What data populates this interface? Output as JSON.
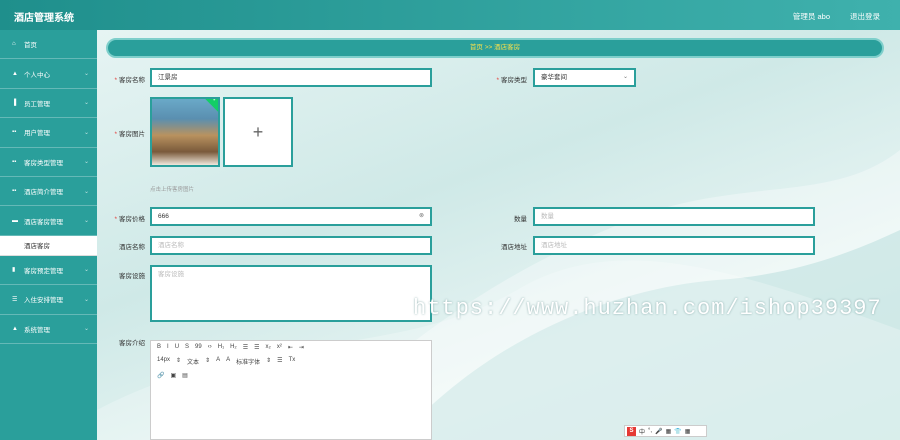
{
  "app": {
    "title": "酒店管理系统",
    "admin": "管理员 abo",
    "logout": "退出登录"
  },
  "sidebar": {
    "items": [
      {
        "label": "首页",
        "icon": "home-icon",
        "glyph": "⌂"
      },
      {
        "label": "个人中心",
        "icon": "user-icon",
        "glyph": "▲"
      },
      {
        "label": "员工管理",
        "icon": "bar-icon",
        "glyph": "▐"
      },
      {
        "label": "用户管理",
        "icon": "grid-icon",
        "glyph": "▪▪"
      },
      {
        "label": "客房类型管理",
        "icon": "grid-icon",
        "glyph": "▪▪"
      },
      {
        "label": "酒店简介管理",
        "icon": "grid-icon",
        "glyph": "▪▪"
      },
      {
        "label": "酒店客房管理",
        "icon": "chat-icon",
        "glyph": "▬"
      },
      {
        "sub": "酒店客房"
      },
      {
        "label": "客房预定管理",
        "icon": "chart-icon",
        "glyph": "▮"
      },
      {
        "label": "入住安排管理",
        "icon": "list-icon",
        "glyph": "☰"
      },
      {
        "label": "系统管理",
        "icon": "user-icon",
        "glyph": "▲"
      }
    ]
  },
  "breadcrumb": {
    "text": "首页 >> 酒店客房"
  },
  "form": {
    "room_name": {
      "label": "客房名称",
      "value": "江景房"
    },
    "room_type": {
      "label": "客房类型",
      "value": "豪华套间"
    },
    "room_image": {
      "label": "客房图片",
      "hint": "点击上传客房图片",
      "plus": "+"
    },
    "price": {
      "label": "客房价格",
      "value": "666"
    },
    "quantity": {
      "label": "数量",
      "placeholder": "数量"
    },
    "hotel_name": {
      "label": "酒店名称",
      "placeholder": "酒店名称"
    },
    "hotel_address": {
      "label": "酒店地址",
      "placeholder": "酒店地址"
    },
    "facilities": {
      "label": "客房设施",
      "placeholder": "客房设施"
    },
    "intro": {
      "label": "客房介绍"
    }
  },
  "editor": {
    "row1": [
      "B",
      "I",
      "U",
      "S",
      "99",
      "‹›",
      "H₁",
      "H₂",
      "☰",
      "☰",
      "x₂",
      "x²",
      "⇤",
      "⇥"
    ],
    "row2": [
      "14px",
      "⇕",
      "文本",
      "⇕",
      "A",
      "A",
      "标准字体",
      "⇕",
      "☰",
      "Tx"
    ],
    "row3": [
      "🔗",
      "▣",
      "▤"
    ]
  },
  "watermark": "https://www.huzhan.com/ishop39397",
  "ime": {
    "glyphs": [
      "S",
      "中",
      "°,",
      "🎤",
      "▦",
      "👕",
      "▦"
    ]
  }
}
